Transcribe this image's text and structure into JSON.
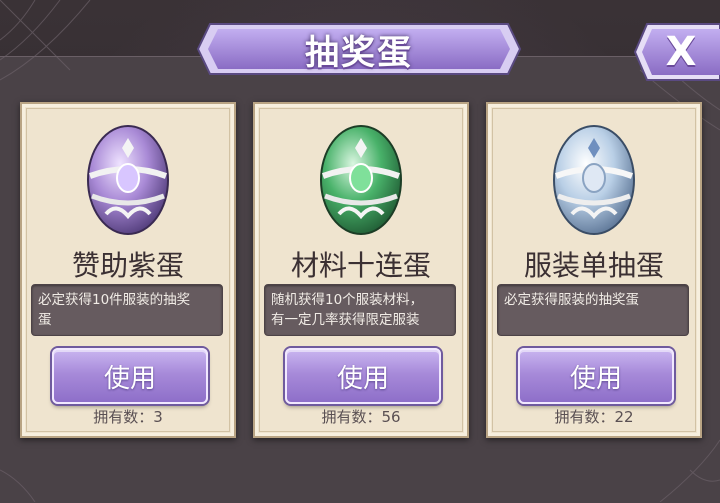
{
  "title": "抽奖蛋",
  "close_label": "X",
  "button_label": "使用",
  "cards": [
    {
      "name": "赞助紫蛋",
      "desc_line1": "必定获得10件服装的抽奖",
      "desc_line2": "蛋",
      "owned": "拥有数：3",
      "egg_color": "#a98ad6"
    },
    {
      "name": "材料十连蛋",
      "desc_line1": "随机获得10个服装材料，",
      "desc_line2": "有一定几率获得限定服装",
      "owned": "拥有数：56",
      "egg_color": "#49b26a"
    },
    {
      "name": "服装单抽蛋",
      "desc_line1": "必定获得服装的抽奖蛋",
      "desc_line2": "",
      "owned": "拥有数：22",
      "egg_color": "#b9cfe6"
    }
  ],
  "colors": {
    "accent": "#a78ad9",
    "card_bg": "#efe4cf",
    "panel": "#4a4247"
  },
  "icons": {
    "close": "close-icon",
    "egg": "egg-icon"
  }
}
